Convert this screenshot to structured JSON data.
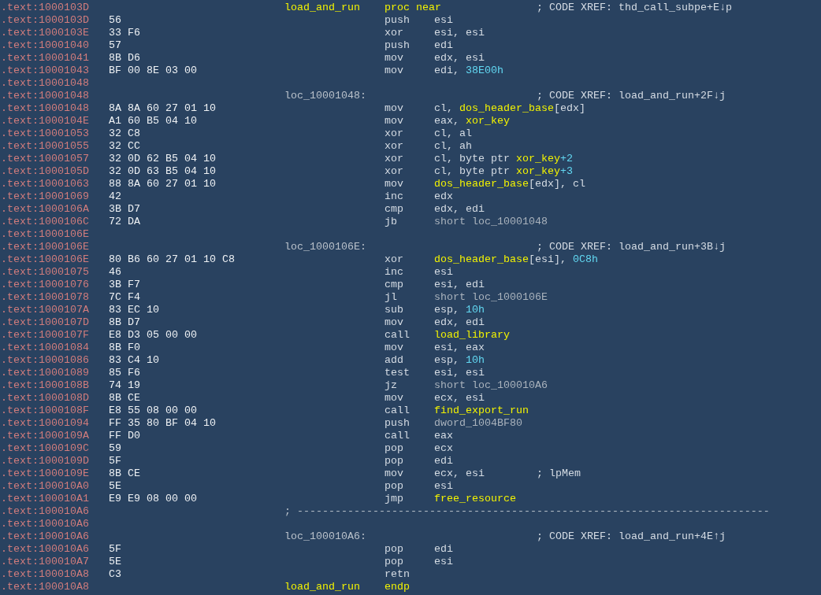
{
  "lines": [
    {
      "address": ".text:1000103D",
      "label": {
        "text": "load_and_run",
        "kind": "proc"
      },
      "mnemonic": {
        "text": "proc near",
        "kind": "directive"
      },
      "comment": "; CODE XREF: thd_call_subpe+E↓p"
    },
    {
      "address": ".text:1000103D",
      "bytes": "56",
      "mnemonic": {
        "text": "push",
        "kind": "instruction"
      },
      "operands": [
        {
          "text": "esi",
          "kind": "plain"
        }
      ]
    },
    {
      "address": ".text:1000103E",
      "bytes": "33 F6",
      "mnemonic": {
        "text": "xor",
        "kind": "instruction"
      },
      "operands": [
        {
          "text": "esi, esi",
          "kind": "plain"
        }
      ]
    },
    {
      "address": ".text:10001040",
      "bytes": "57",
      "mnemonic": {
        "text": "push",
        "kind": "instruction"
      },
      "operands": [
        {
          "text": "edi",
          "kind": "plain"
        }
      ]
    },
    {
      "address": ".text:10001041",
      "bytes": "8B D6",
      "mnemonic": {
        "text": "mov",
        "kind": "instruction"
      },
      "operands": [
        {
          "text": "edx, esi",
          "kind": "plain"
        }
      ]
    },
    {
      "address": ".text:10001043",
      "bytes": "BF 00 8E 03 00",
      "mnemonic": {
        "text": "mov",
        "kind": "instruction"
      },
      "operands": [
        {
          "text": "edi, ",
          "kind": "plain"
        },
        {
          "text": "38E00h",
          "kind": "number"
        }
      ]
    },
    {
      "address": ".text:10001048"
    },
    {
      "address": ".text:10001048",
      "label": {
        "text": "loc_10001048:",
        "kind": "loc"
      },
      "comment": "; CODE XREF: load_and_run+2F↓j"
    },
    {
      "address": ".text:10001048",
      "bytes": "8A 8A 60 27 01 10",
      "mnemonic": {
        "text": "mov",
        "kind": "instruction"
      },
      "operands": [
        {
          "text": "cl, ",
          "kind": "plain"
        },
        {
          "text": "dos_header_base",
          "kind": "name"
        },
        {
          "text": "[edx]",
          "kind": "plain"
        }
      ]
    },
    {
      "address": ".text:1000104E",
      "bytes": "A1 60 B5 04 10",
      "mnemonic": {
        "text": "mov",
        "kind": "instruction"
      },
      "operands": [
        {
          "text": "eax, ",
          "kind": "plain"
        },
        {
          "text": "xor_key",
          "kind": "name"
        }
      ]
    },
    {
      "address": ".text:10001053",
      "bytes": "32 C8",
      "mnemonic": {
        "text": "xor",
        "kind": "instruction"
      },
      "operands": [
        {
          "text": "cl, al",
          "kind": "plain"
        }
      ]
    },
    {
      "address": ".text:10001055",
      "bytes": "32 CC",
      "mnemonic": {
        "text": "xor",
        "kind": "instruction"
      },
      "operands": [
        {
          "text": "cl, ah",
          "kind": "plain"
        }
      ]
    },
    {
      "address": ".text:10001057",
      "bytes": "32 0D 62 B5 04 10",
      "mnemonic": {
        "text": "xor",
        "kind": "instruction"
      },
      "operands": [
        {
          "text": "cl, byte ptr ",
          "kind": "plain"
        },
        {
          "text": "xor_key",
          "kind": "name"
        },
        {
          "text": "+2",
          "kind": "number"
        }
      ]
    },
    {
      "address": ".text:1000105D",
      "bytes": "32 0D 63 B5 04 10",
      "mnemonic": {
        "text": "xor",
        "kind": "instruction"
      },
      "operands": [
        {
          "text": "cl, byte ptr ",
          "kind": "plain"
        },
        {
          "text": "xor_key",
          "kind": "name"
        },
        {
          "text": "+3",
          "kind": "number"
        }
      ]
    },
    {
      "address": ".text:10001063",
      "bytes": "88 8A 60 27 01 10",
      "mnemonic": {
        "text": "mov",
        "kind": "instruction"
      },
      "operands": [
        {
          "text": "dos_header_base",
          "kind": "name"
        },
        {
          "text": "[edx], cl",
          "kind": "plain"
        }
      ]
    },
    {
      "address": ".text:10001069",
      "bytes": "42",
      "mnemonic": {
        "text": "inc",
        "kind": "instruction"
      },
      "operands": [
        {
          "text": "edx",
          "kind": "plain"
        }
      ]
    },
    {
      "address": ".text:1000106A",
      "bytes": "3B D7",
      "mnemonic": {
        "text": "cmp",
        "kind": "instruction"
      },
      "operands": [
        {
          "text": "edx, edi",
          "kind": "plain"
        }
      ]
    },
    {
      "address": ".text:1000106C",
      "bytes": "72 DA",
      "mnemonic": {
        "text": "jb",
        "kind": "instruction"
      },
      "operands": [
        {
          "text": "short loc_10001048",
          "kind": "ref"
        }
      ]
    },
    {
      "address": ".text:1000106E"
    },
    {
      "address": ".text:1000106E",
      "label": {
        "text": "loc_1000106E:",
        "kind": "loc"
      },
      "comment": "; CODE XREF: load_and_run+3B↓j"
    },
    {
      "address": ".text:1000106E",
      "bytes": "80 B6 60 27 01 10 C8",
      "mnemonic": {
        "text": "xor",
        "kind": "instruction"
      },
      "operands": [
        {
          "text": "dos_header_base",
          "kind": "name"
        },
        {
          "text": "[esi], ",
          "kind": "plain"
        },
        {
          "text": "0C8h",
          "kind": "number"
        }
      ]
    },
    {
      "address": ".text:10001075",
      "bytes": "46",
      "mnemonic": {
        "text": "inc",
        "kind": "instruction"
      },
      "operands": [
        {
          "text": "esi",
          "kind": "plain"
        }
      ]
    },
    {
      "address": ".text:10001076",
      "bytes": "3B F7",
      "mnemonic": {
        "text": "cmp",
        "kind": "instruction"
      },
      "operands": [
        {
          "text": "esi, edi",
          "kind": "plain"
        }
      ]
    },
    {
      "address": ".text:10001078",
      "bytes": "7C F4",
      "mnemonic": {
        "text": "jl",
        "kind": "instruction"
      },
      "operands": [
        {
          "text": "short loc_1000106E",
          "kind": "ref"
        }
      ]
    },
    {
      "address": ".text:1000107A",
      "bytes": "83 EC 10",
      "mnemonic": {
        "text": "sub",
        "kind": "instruction"
      },
      "operands": [
        {
          "text": "esp, ",
          "kind": "plain"
        },
        {
          "text": "10h",
          "kind": "number"
        }
      ]
    },
    {
      "address": ".text:1000107D",
      "bytes": "8B D7",
      "mnemonic": {
        "text": "mov",
        "kind": "instruction"
      },
      "operands": [
        {
          "text": "edx, edi",
          "kind": "plain"
        }
      ]
    },
    {
      "address": ".text:1000107F",
      "bytes": "E8 D3 05 00 00",
      "mnemonic": {
        "text": "call",
        "kind": "instruction"
      },
      "operands": [
        {
          "text": "load_library",
          "kind": "name"
        }
      ]
    },
    {
      "address": ".text:10001084",
      "bytes": "8B F0",
      "mnemonic": {
        "text": "mov",
        "kind": "instruction"
      },
      "operands": [
        {
          "text": "esi, eax",
          "kind": "plain"
        }
      ]
    },
    {
      "address": ".text:10001086",
      "bytes": "83 C4 10",
      "mnemonic": {
        "text": "add",
        "kind": "instruction"
      },
      "operands": [
        {
          "text": "esp, ",
          "kind": "plain"
        },
        {
          "text": "10h",
          "kind": "number"
        }
      ]
    },
    {
      "address": ".text:10001089",
      "bytes": "85 F6",
      "mnemonic": {
        "text": "test",
        "kind": "instruction"
      },
      "operands": [
        {
          "text": "esi, esi",
          "kind": "plain"
        }
      ]
    },
    {
      "address": ".text:1000108B",
      "bytes": "74 19",
      "mnemonic": {
        "text": "jz",
        "kind": "instruction"
      },
      "operands": [
        {
          "text": "short loc_100010A6",
          "kind": "ref"
        }
      ]
    },
    {
      "address": ".text:1000108D",
      "bytes": "8B CE",
      "mnemonic": {
        "text": "mov",
        "kind": "instruction"
      },
      "operands": [
        {
          "text": "ecx, esi",
          "kind": "plain"
        }
      ]
    },
    {
      "address": ".text:1000108F",
      "bytes": "E8 55 08 00 00",
      "mnemonic": {
        "text": "call",
        "kind": "instruction"
      },
      "operands": [
        {
          "text": "find_export_run",
          "kind": "name"
        }
      ]
    },
    {
      "address": ".text:10001094",
      "bytes": "FF 35 80 BF 04 10",
      "mnemonic": {
        "text": "push",
        "kind": "instruction"
      },
      "operands": [
        {
          "text": "dword_1004BF80",
          "kind": "ref"
        }
      ]
    },
    {
      "address": ".text:1000109A",
      "bytes": "FF D0",
      "mnemonic": {
        "text": "call",
        "kind": "instruction"
      },
      "operands": [
        {
          "text": "eax",
          "kind": "plain"
        }
      ]
    },
    {
      "address": ".text:1000109C",
      "bytes": "59",
      "mnemonic": {
        "text": "pop",
        "kind": "instruction"
      },
      "operands": [
        {
          "text": "ecx",
          "kind": "plain"
        }
      ]
    },
    {
      "address": ".text:1000109D",
      "bytes": "5F",
      "mnemonic": {
        "text": "pop",
        "kind": "instruction"
      },
      "operands": [
        {
          "text": "edi",
          "kind": "plain"
        }
      ]
    },
    {
      "address": ".text:1000109E",
      "bytes": "8B CE",
      "mnemonic": {
        "text": "mov",
        "kind": "instruction"
      },
      "operands": [
        {
          "text": "ecx, esi",
          "kind": "plain"
        }
      ],
      "comment": "; lpMem"
    },
    {
      "address": ".text:100010A0",
      "bytes": "5E",
      "mnemonic": {
        "text": "pop",
        "kind": "instruction"
      },
      "operands": [
        {
          "text": "esi",
          "kind": "plain"
        }
      ]
    },
    {
      "address": ".text:100010A1",
      "bytes": "E9 E9 08 00 00",
      "mnemonic": {
        "text": "jmp",
        "kind": "instruction"
      },
      "operands": [
        {
          "text": "free_resource",
          "kind": "name"
        }
      ]
    },
    {
      "address": ".text:100010A6",
      "separator": "; ---------------------------------------------------------------------------"
    },
    {
      "address": ".text:100010A6"
    },
    {
      "address": ".text:100010A6",
      "label": {
        "text": "loc_100010A6:",
        "kind": "loc"
      },
      "comment": "; CODE XREF: load_and_run+4E↑j"
    },
    {
      "address": ".text:100010A6",
      "bytes": "5F",
      "mnemonic": {
        "text": "pop",
        "kind": "instruction"
      },
      "operands": [
        {
          "text": "edi",
          "kind": "plain"
        }
      ]
    },
    {
      "address": ".text:100010A7",
      "bytes": "5E",
      "mnemonic": {
        "text": "pop",
        "kind": "instruction"
      },
      "operands": [
        {
          "text": "esi",
          "kind": "plain"
        }
      ]
    },
    {
      "address": ".text:100010A8",
      "bytes": "C3",
      "mnemonic": {
        "text": "retn",
        "kind": "instruction"
      }
    },
    {
      "address": ".text:100010A8",
      "label": {
        "text": "load_and_run",
        "kind": "proc"
      },
      "mnemonic": {
        "text": "endp",
        "kind": "directive"
      }
    }
  ]
}
